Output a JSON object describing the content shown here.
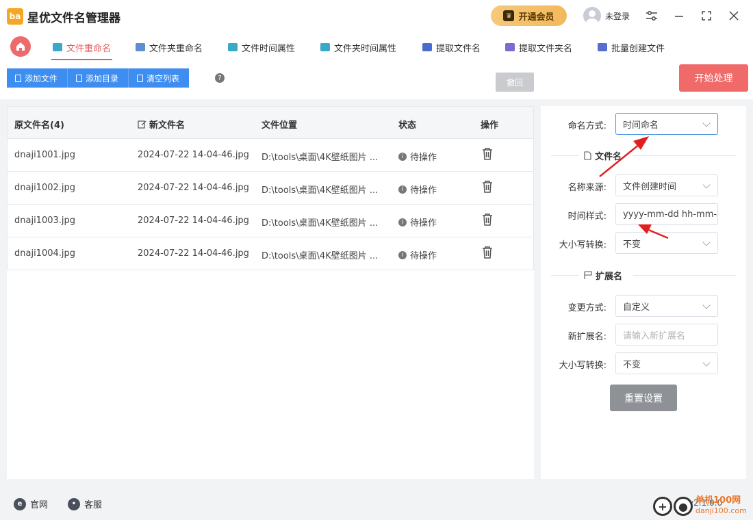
{
  "app": {
    "title": "星优文件名管理器",
    "logo_text": "ba"
  },
  "header": {
    "vip_label": "开通会员",
    "user_label": "未登录"
  },
  "tabs": [
    {
      "label": "文件重命名",
      "active": true,
      "color": "#3aa8c8"
    },
    {
      "label": "文件夹重命名",
      "active": false,
      "color": "#5b8fd0"
    },
    {
      "label": "文件时间属性",
      "active": false,
      "color": "#3aa8c8"
    },
    {
      "label": "文件夹时间属性",
      "active": false,
      "color": "#3aa8c8"
    },
    {
      "label": "提取文件名",
      "active": false,
      "color": "#4a6bd0"
    },
    {
      "label": "提取文件夹名",
      "active": false,
      "color": "#7a6bd0"
    },
    {
      "label": "批量创建文件",
      "active": false,
      "color": "#5a6bd0"
    }
  ],
  "toolbar": {
    "add_file": "添加文件",
    "add_dir": "添加目录",
    "clear_list": "清空列表",
    "help": "?",
    "undo": "撤回",
    "start": "开始处理"
  },
  "table": {
    "headers": [
      "原文件名(4)",
      "新文件名",
      "文件位置",
      "状态",
      "操作"
    ],
    "rows": [
      {
        "orig": "dnaji1001.jpg",
        "new": "2024-07-22 14-04-46.jpg",
        "path": "D:\\tools\\桌面\\4K壁纸图片 ...",
        "status": "待操作"
      },
      {
        "orig": "dnaji1002.jpg",
        "new": "2024-07-22 14-04-46.jpg",
        "path": "D:\\tools\\桌面\\4K壁纸图片 ...",
        "status": "待操作"
      },
      {
        "orig": "dnaji1003.jpg",
        "new": "2024-07-22 14-04-46.jpg",
        "path": "D:\\tools\\桌面\\4K壁纸图片 ...",
        "status": "待操作"
      },
      {
        "orig": "dnaji1004.jpg",
        "new": "2024-07-22 14-04-46.jpg",
        "path": "D:\\tools\\桌面\\4K壁纸图片 ...",
        "status": "待操作"
      }
    ]
  },
  "panel": {
    "naming_method_label": "命名方式:",
    "naming_method_value": "时间命名",
    "section_filename": "文件名",
    "name_source_label": "名称来源:",
    "name_source_value": "文件创建时间",
    "time_style_label": "时间样式:",
    "time_style_value": "yyyy-mm-dd hh-mm-ss",
    "case_label": "大小写转换:",
    "case_value": "不变",
    "section_ext": "扩展名",
    "change_method_label": "变更方式:",
    "change_method_value": "自定义",
    "new_ext_label": "新扩展名:",
    "new_ext_placeholder": "请输入新扩展名",
    "ext_case_label": "大小写转换:",
    "ext_case_value": "不变",
    "reset": "重置设置"
  },
  "footer": {
    "website": "官网",
    "support": "客服",
    "version": "v2.1.0.0"
  },
  "watermark": {
    "title": "单机100网",
    "url": "danji100.com"
  },
  "colors": {
    "accent": "#3d8ef0",
    "brand_red": "#f06a6a",
    "annotation_arrow": "#e02020"
  }
}
